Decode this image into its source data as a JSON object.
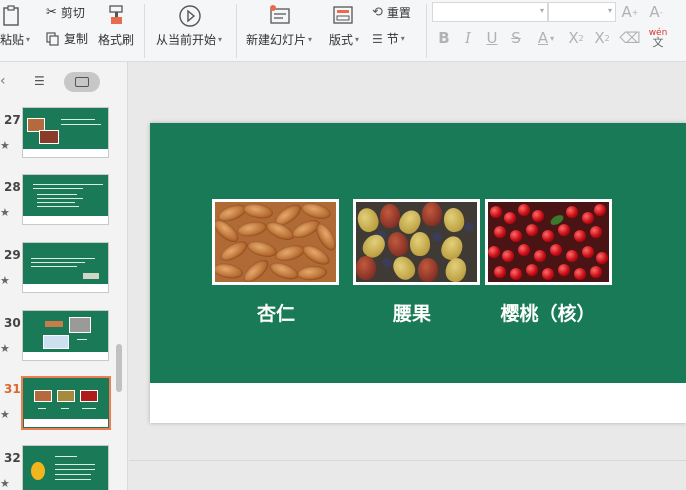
{
  "ribbon": {
    "paste_label": "粘贴",
    "cut_label": "剪切",
    "copy_label": "复制",
    "format_painter_label": "格式刷",
    "from_current_label": "从当前开始",
    "new_slide_label": "新建幻灯片",
    "layout_label": "版式",
    "reset_label": "重置",
    "section_label": "节",
    "font_name_value": "",
    "font_size_value": "",
    "phonetic_label": "wén"
  },
  "panel": {
    "slides": [
      {
        "number": "27"
      },
      {
        "number": "28"
      },
      {
        "number": "29"
      },
      {
        "number": "30"
      },
      {
        "number": "31"
      },
      {
        "number": "32"
      }
    ],
    "star_glyph": "★",
    "collapse_glyph": "‹"
  },
  "slide": {
    "captions": [
      "杏仁",
      "腰果",
      "樱桃（核）"
    ],
    "background_color": "#187a56"
  },
  "colors": {
    "accent_selected": "#f07c52",
    "slide_green": "#187a56"
  }
}
